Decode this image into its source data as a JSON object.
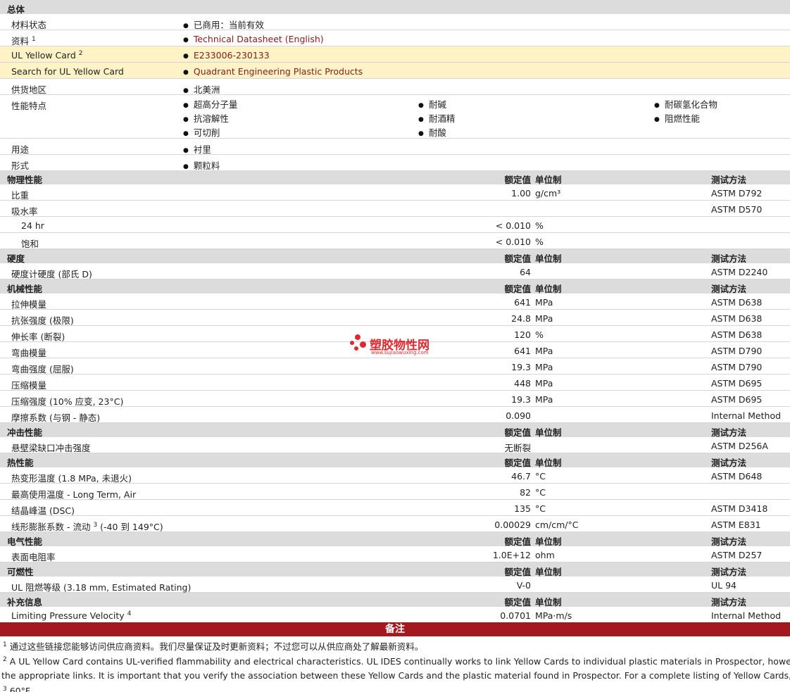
{
  "general": {
    "title": "总体",
    "material_status": {
      "label": "材料状态",
      "value": "已商用：当前有效"
    },
    "data_source": {
      "label": "资料",
      "sup": "1",
      "value": "Technical Datasheet (English)"
    },
    "ul_yellow_card": {
      "label": "UL Yellow Card",
      "sup": "2",
      "value": "E233006-230133"
    },
    "search_ul": {
      "label": "Search for UL Yellow Card",
      "value": "Quadrant Engineering Plastic Products"
    },
    "region": {
      "label": "供货地区",
      "value": "北美洲"
    },
    "features": {
      "label": "性能特点",
      "col1": [
        "超高分子量",
        "抗溶解性",
        "可切削"
      ],
      "col2": [
        "耐碱",
        "耐酒精",
        "耐酸"
      ],
      "col3": [
        "耐碳氢化合物",
        "阻燃性能"
      ]
    },
    "uses": {
      "label": "用途",
      "value": "衬里"
    },
    "forms": {
      "label": "形式",
      "value": "颗粒料"
    }
  },
  "headers": {
    "nominal": "额定值",
    "unit": "单位制",
    "method": "测试方法"
  },
  "physical": {
    "title": "物理性能",
    "rows": [
      {
        "label": "比重",
        "value": "1.00",
        "unit": "g/cm³",
        "method": "ASTM D792"
      },
      {
        "label": "吸水率",
        "value": "",
        "unit": "",
        "method": "ASTM D570"
      },
      {
        "label": "24 hr",
        "value": "< 0.010",
        "unit": "%",
        "method": ""
      },
      {
        "label": "饱和",
        "value": "< 0.010",
        "unit": "%",
        "method": ""
      }
    ]
  },
  "hardness": {
    "title": "硬度",
    "rows": [
      {
        "label": "硬度计硬度 (部氏 D)",
        "value": "64",
        "unit": "",
        "method": "ASTM D2240"
      }
    ]
  },
  "mechanical": {
    "title": "机械性能",
    "rows": [
      {
        "label": "拉伸模量",
        "value": "641",
        "unit": "MPa",
        "method": "ASTM D638"
      },
      {
        "label": "抗张强度 (极限)",
        "value": "24.8",
        "unit": "MPa",
        "method": "ASTM D638"
      },
      {
        "label": "伸长率 (断裂)",
        "value": "120",
        "unit": "%",
        "method": "ASTM D638"
      },
      {
        "label": "弯曲模量",
        "value": "641",
        "unit": "MPa",
        "method": "ASTM D790"
      },
      {
        "label": "弯曲强度 (屈服)",
        "value": "19.3",
        "unit": "MPa",
        "method": "ASTM D790"
      },
      {
        "label": "压缩模量",
        "value": "448",
        "unit": "MPa",
        "method": "ASTM D695"
      },
      {
        "label": "压缩强度 (10% 应变, 23°C)",
        "value": "19.3",
        "unit": "MPa",
        "method": "ASTM D695"
      },
      {
        "label": "摩擦系数 (与钢 - 静态)",
        "value": "0.090",
        "unit": "",
        "method": "Internal Method"
      }
    ]
  },
  "impact": {
    "title": "冲击性能",
    "rows": [
      {
        "label": "悬壁梁缺口冲击强度",
        "value": "无断裂",
        "unit": "",
        "method": "ASTM D256A"
      }
    ]
  },
  "thermal": {
    "title": "热性能",
    "rows": [
      {
        "label": "热变形温度 (1.8 MPa, 未退火)",
        "value": "46.7",
        "unit": "°C",
        "method": "ASTM D648"
      },
      {
        "label": "最高使用温度 - Long Term, Air",
        "value": "82",
        "unit": "°C",
        "method": ""
      },
      {
        "label": "结晶峰温 (DSC)",
        "value": "135",
        "unit": "°C",
        "method": "ASTM D3418"
      },
      {
        "label": "线形膨胀系数 - 流动",
        "sup": "3",
        "label_suffix": "(-40 到 149°C)",
        "value": "0.00029",
        "unit": "cm/cm/°C",
        "method": "ASTM E831"
      }
    ]
  },
  "electrical": {
    "title": "电气性能",
    "rows": [
      {
        "label": "表面电阻率",
        "value": "1.0E+12",
        "unit": "ohm",
        "method": "ASTM D257"
      }
    ]
  },
  "flammability": {
    "title": "可燃性",
    "rows": [
      {
        "label": "UL 阻燃等级 (3.18 mm, Estimated Rating)",
        "value": "V-0",
        "unit": "",
        "method": "UL 94"
      }
    ]
  },
  "additional": {
    "title": "补充信息",
    "rows": [
      {
        "label": "Limiting Pressure Velocity",
        "sup": "4",
        "value": "0.0701",
        "unit": "MPa·m/s",
        "method": "Internal Method"
      }
    ]
  },
  "notes": {
    "title": "备注",
    "n1": {
      "sup": "1",
      "text": "通过这些链接您能够访问供应商资料。我们尽量保证及时更新资料；不过您可以从供应商处了解最新资料。"
    },
    "n2_line1": {
      "sup": "2",
      "text": "A UL Yellow Card contains UL-verified flammability and electrical characteristics. UL IDES continually works to link Yellow Cards to individual plastic materials in Prospector, however this list"
    },
    "n2_line2": "the appropriate links. It is important that you verify the association between these Yellow Cards and the plastic material found in Prospector. For a complete listing of Yellow Cards, visit the UL Ye",
    "n3": {
      "sup": "3",
      "text": "60°F"
    }
  },
  "watermark": {
    "cn": "塑胶物性网",
    "en": "www.sujiaowuxing.com"
  }
}
